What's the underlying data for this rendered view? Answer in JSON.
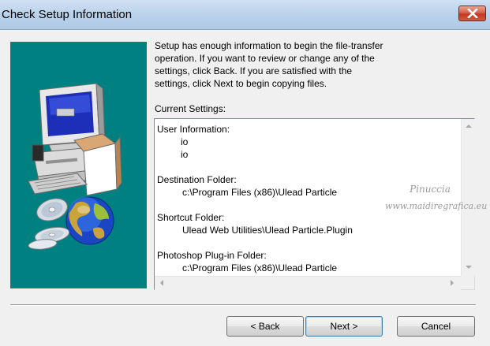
{
  "window": {
    "title": "Check Setup Information",
    "close_label": "×"
  },
  "description": {
    "line1": "Setup has enough information to begin the file-transfer",
    "line2": "operation.  If you want to review or change any of the",
    "line3": "settings, click Back.  If you are satisfied with the",
    "line4": "settings, click Next to begin copying files."
  },
  "current_settings_label": "Current Settings:",
  "settings": {
    "user_info": {
      "title": "User Information:",
      "values": [
        "io",
        "io"
      ]
    },
    "destination": {
      "title": "Destination Folder:",
      "value": "c:\\Program Files (x86)\\Ulead Particle"
    },
    "shortcut": {
      "title": "Shortcut Folder:",
      "value": "Ulead Web Utilities\\Ulead Particle.Plugin"
    },
    "photoshop": {
      "title": "Photoshop Plug-in Folder:",
      "value": "c:\\Program Files (x86)\\Ulead Particle"
    }
  },
  "watermark": {
    "line1": "Pinuccia",
    "line2": "www.maidiregrafica.eu"
  },
  "buttons": {
    "back": "< Back",
    "next": "Next >",
    "cancel": "Cancel"
  },
  "icons": {
    "close": "close-x-icon",
    "illustration": "computer-with-globe-and-cds"
  }
}
